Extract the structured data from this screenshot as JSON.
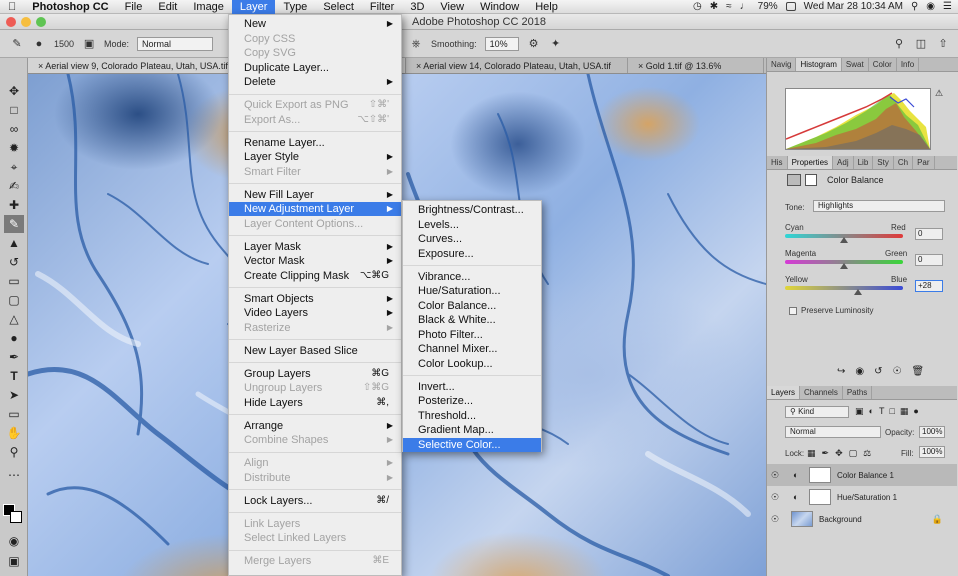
{
  "menubar": {
    "app_name": "Photoshop CC",
    "items": [
      "File",
      "Edit",
      "Image",
      "Layer",
      "Type",
      "Select",
      "Filter",
      "3D",
      "View",
      "Window",
      "Help"
    ],
    "active": "Layer",
    "battery": "79%",
    "datetime": "Wed Mar 28  10:34 AM"
  },
  "window_title": "Adobe Photoshop CC 2018",
  "options_bar": {
    "brush_size": "1500",
    "mode_label": "Mode:",
    "mode_value": "Normal",
    "smoothing_label": "Smoothing:",
    "smoothing_value": "10%"
  },
  "tabs": [
    "Aerial view 9, Colorado Plateau, Utah, USA.tif",
    "Aerial view 14, Colorado Plateau, Utah, USA.tif",
    "Gold 1.tif @ 13.6%"
  ],
  "layer_menu": {
    "items": [
      {
        "label": "New",
        "arrow": true
      },
      {
        "label": "Copy CSS",
        "disabled": true
      },
      {
        "label": "Copy SVG",
        "disabled": true
      },
      {
        "label": "Duplicate Layer..."
      },
      {
        "label": "Delete",
        "arrow": true
      },
      {
        "sep": true
      },
      {
        "label": "Quick Export as PNG",
        "disabled": true,
        "shortcut": "⇧⌘'"
      },
      {
        "label": "Export As...",
        "disabled": true,
        "shortcut": "⌥⇧⌘'"
      },
      {
        "sep": true
      },
      {
        "label": "Rename Layer..."
      },
      {
        "label": "Layer Style",
        "arrow": true
      },
      {
        "label": "Smart Filter",
        "disabled": true,
        "arrow": true
      },
      {
        "sep": true
      },
      {
        "label": "New Fill Layer",
        "arrow": true
      },
      {
        "label": "New Adjustment Layer",
        "arrow": true,
        "highlighted": true
      },
      {
        "label": "Layer Content Options...",
        "disabled": true
      },
      {
        "sep": true
      },
      {
        "label": "Layer Mask",
        "arrow": true
      },
      {
        "label": "Vector Mask",
        "arrow": true
      },
      {
        "label": "Create Clipping Mask",
        "shortcut": "⌥⌘G"
      },
      {
        "sep": true
      },
      {
        "label": "Smart Objects",
        "arrow": true
      },
      {
        "label": "Video Layers",
        "arrow": true
      },
      {
        "label": "Rasterize",
        "disabled": true,
        "arrow": true
      },
      {
        "sep": true
      },
      {
        "label": "New Layer Based Slice"
      },
      {
        "sep": true
      },
      {
        "label": "Group Layers",
        "shortcut": "⌘G"
      },
      {
        "label": "Ungroup Layers",
        "disabled": true,
        "shortcut": "⇧⌘G"
      },
      {
        "label": "Hide Layers",
        "shortcut": "⌘,"
      },
      {
        "sep": true
      },
      {
        "label": "Arrange",
        "arrow": true
      },
      {
        "label": "Combine Shapes",
        "disabled": true,
        "arrow": true
      },
      {
        "sep": true
      },
      {
        "label": "Align",
        "disabled": true,
        "arrow": true
      },
      {
        "label": "Distribute",
        "disabled": true,
        "arrow": true
      },
      {
        "sep": true
      },
      {
        "label": "Lock Layers...",
        "shortcut": "⌘/"
      },
      {
        "sep": true
      },
      {
        "label": "Link Layers",
        "disabled": true
      },
      {
        "label": "Select Linked Layers",
        "disabled": true
      },
      {
        "sep": true
      },
      {
        "label": "Merge Layers",
        "disabled": true,
        "shortcut": "⌘E"
      }
    ]
  },
  "adjustment_submenu": {
    "items": [
      {
        "label": "Brightness/Contrast..."
      },
      {
        "label": "Levels..."
      },
      {
        "label": "Curves..."
      },
      {
        "label": "Exposure..."
      },
      {
        "sep": true
      },
      {
        "label": "Vibrance..."
      },
      {
        "label": "Hue/Saturation..."
      },
      {
        "label": "Color Balance..."
      },
      {
        "label": "Black & White..."
      },
      {
        "label": "Photo Filter..."
      },
      {
        "label": "Channel Mixer..."
      },
      {
        "label": "Color Lookup..."
      },
      {
        "sep": true
      },
      {
        "label": "Invert..."
      },
      {
        "label": "Posterize..."
      },
      {
        "label": "Threshold..."
      },
      {
        "label": "Gradient Map..."
      },
      {
        "label": "Selective Color...",
        "highlighted": true
      }
    ]
  },
  "panels": {
    "top_tabs": [
      "Navig",
      "Histogram",
      "Swat",
      "Color",
      "Info"
    ],
    "top_active": "Histogram",
    "prop_tabs": [
      "His",
      "Properties",
      "Adj",
      "Lib",
      "Sty",
      "Ch",
      "Par"
    ],
    "prop_active": "Properties",
    "properties_title": "Color Balance",
    "tone_label": "Tone:",
    "tone_value": "Highlights",
    "sliders": [
      {
        "left": "Cyan",
        "right": "Red",
        "value": "0",
        "level": 0.5,
        "color": "linear-gradient(90deg,#2fd6d6,#e03a3a)"
      },
      {
        "left": "Magenta",
        "right": "Green",
        "value": "0",
        "level": 0.5,
        "color": "linear-gradient(90deg,#d63ad6,#3ad63a)"
      },
      {
        "left": "Yellow",
        "right": "Blue",
        "value": "+28",
        "level": 0.62,
        "color": "linear-gradient(90deg,#e0d63a,#3a4ad6)"
      }
    ],
    "preserve_label": "Preserve Luminosity",
    "layers_tabs": [
      "Layers",
      "Channels",
      "Paths"
    ],
    "layers_active": "Layers",
    "kind_label": "Kind",
    "blend_mode": "Normal",
    "opacity_label": "Opacity:",
    "opacity_value": "100%",
    "lock_label": "Lock:",
    "fill_label": "Fill:",
    "fill_value": "100%",
    "layers": [
      {
        "name": "Color Balance 1",
        "selected": true
      },
      {
        "name": "Hue/Saturation 1",
        "selected": false
      },
      {
        "name": "Background",
        "selected": false
      }
    ]
  },
  "colors": {
    "menu_highlight": "#3b7ce8"
  }
}
